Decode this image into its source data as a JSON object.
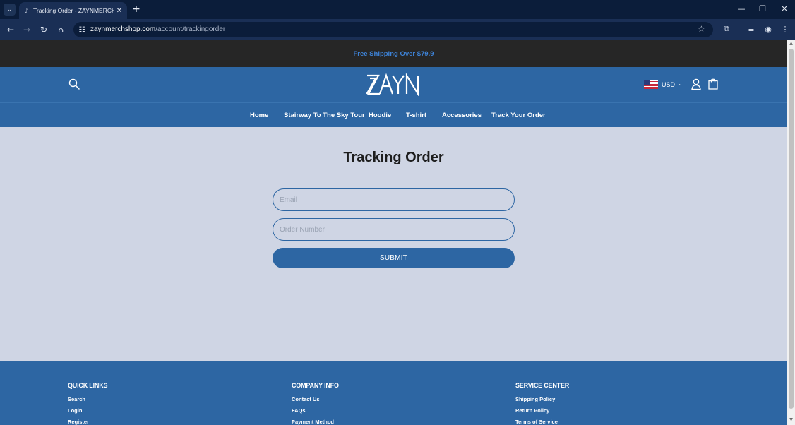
{
  "browser": {
    "tab_title": "Tracking Order - ZAYNMERCHSHOP",
    "url_host": "zaynmerchshop.com",
    "url_path": "/account/trackingorder"
  },
  "announcement": {
    "text": "Free Shipping Over $79.9"
  },
  "header": {
    "currency": "USD"
  },
  "nav": {
    "items": [
      "Home",
      "Stairway To The Sky Tour",
      "Hoodie",
      "T-shirt",
      "Accessories",
      "Track Your Order"
    ]
  },
  "main": {
    "title": "Tracking Order",
    "email_placeholder": "Email",
    "order_placeholder": "Order Number",
    "submit_label": "SUBMIT"
  },
  "footer": {
    "quick_links": {
      "heading": "QUICK LINKS",
      "links": [
        "Search",
        "Login",
        "Register"
      ]
    },
    "company_info": {
      "heading": "COMPANY INFO",
      "links": [
        "Contact Us",
        "FAQs",
        "Payment Method"
      ]
    },
    "service_center": {
      "heading": "SERVICE CENTER",
      "links": [
        "Shipping Policy",
        "Return Policy",
        "Terms of Service"
      ]
    }
  },
  "colors": {
    "brand_blue": "#2d66a3",
    "announce_bg": "#262626",
    "page_bg": "#cfd5e4"
  }
}
